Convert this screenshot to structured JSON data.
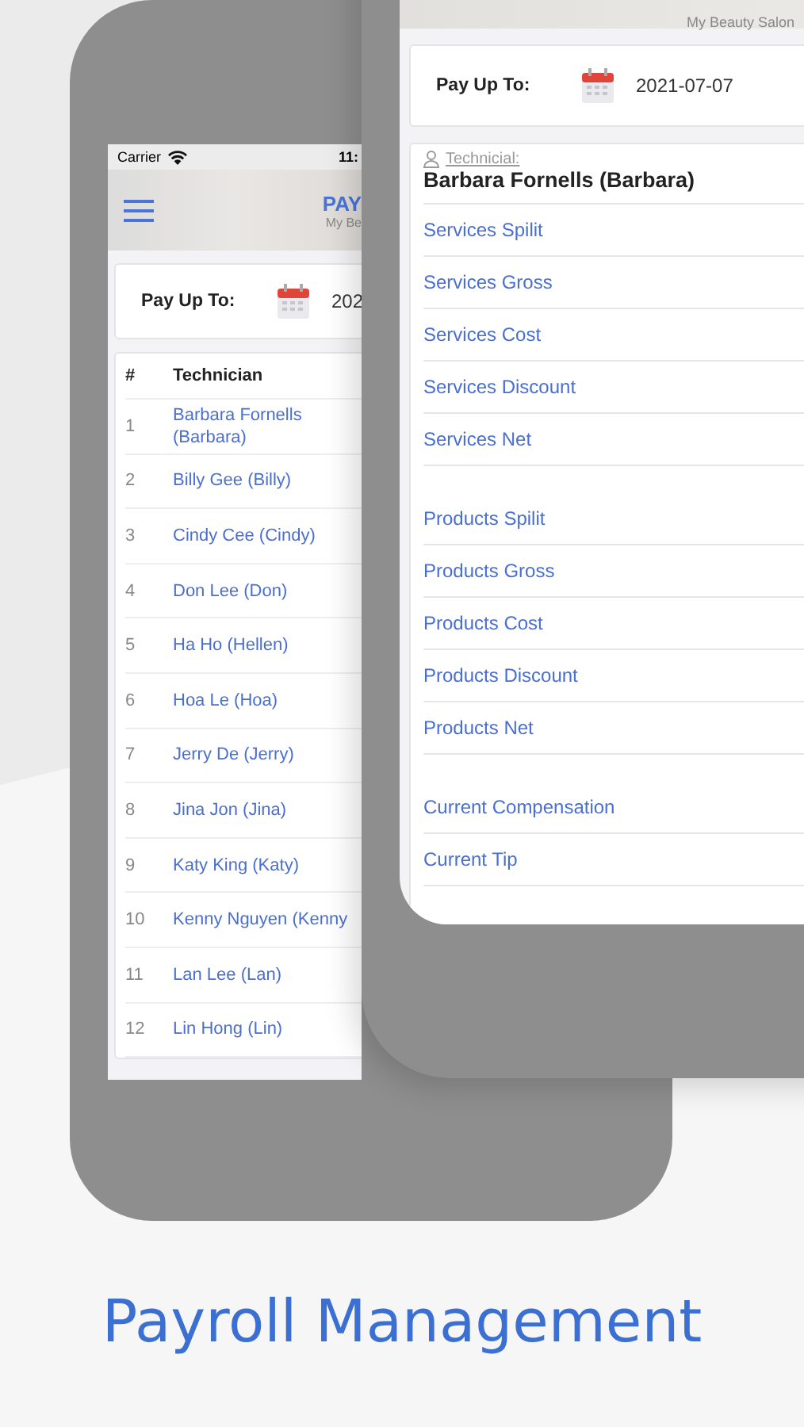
{
  "back_phone": {
    "status_bar": {
      "carrier": "Carrier",
      "time": "11:"
    },
    "header": {
      "title": "PAY",
      "subtitle": "My Be"
    },
    "pay_up_to": {
      "label": "Pay Up To:",
      "date": "202"
    },
    "table": {
      "columns": [
        "#",
        "Technician"
      ],
      "rows": [
        {
          "number": "1",
          "technician": "Barbara Fornells (Barbara)"
        },
        {
          "number": "2",
          "technician": "Billy Gee (Billy)"
        },
        {
          "number": "3",
          "technician": "Cindy Cee (Cindy)"
        },
        {
          "number": "4",
          "technician": "Don Lee (Don)"
        },
        {
          "number": "5",
          "technician": "Ha Ho (Hellen)"
        },
        {
          "number": "6",
          "technician": "Hoa Le (Hoa)"
        },
        {
          "number": "7",
          "technician": "Jerry De (Jerry)"
        },
        {
          "number": "8",
          "technician": "Jina Jon (Jina)"
        },
        {
          "number": "9",
          "technician": "Katy King (Katy)"
        },
        {
          "number": "10",
          "technician": "Kenny Nguyen (Kenny"
        },
        {
          "number": "11",
          "technician": "Lan Lee (Lan)"
        },
        {
          "number": "12",
          "technician": "Lin Hong (Lin)"
        }
      ]
    }
  },
  "front_phone": {
    "header": {
      "subtitle": "My Beauty Salon"
    },
    "pay_up_to": {
      "label": "Pay Up To:",
      "date": "2021-07-07"
    },
    "technician": {
      "label": "Technicial:",
      "name": "Barbara Fornells (Barbara)"
    },
    "groups": [
      {
        "items": [
          "Services Spilit",
          "Services Gross",
          "Services Cost",
          "Services Discount",
          "Services Net"
        ]
      },
      {
        "items": [
          "Products Spilit",
          "Products Gross",
          "Products Cost",
          "Products Discount",
          "Products Net"
        ]
      },
      {
        "items": [
          "Current Compensation",
          "Current Tip"
        ]
      }
    ]
  },
  "caption": "Payroll Management"
}
